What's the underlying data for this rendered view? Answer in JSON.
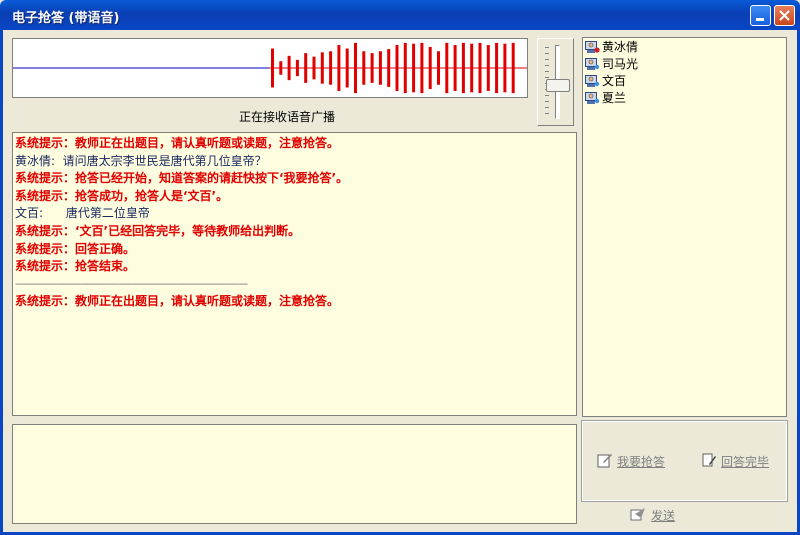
{
  "window": {
    "title": "电子抢答 (带语音)"
  },
  "audio": {
    "status": "正在接收语音广播",
    "bars": [
      0.72,
      0.25,
      0.45,
      0.3,
      0.55,
      0.42,
      0.58,
      0.62,
      0.85,
      0.72,
      0.93,
      0.62,
      0.55,
      0.62,
      0.7,
      0.85,
      0.93,
      0.9,
      0.93,
      0.78,
      0.62,
      0.93,
      0.85,
      0.93,
      0.9,
      0.93,
      0.85,
      0.93,
      0.9,
      0.93
    ]
  },
  "users": [
    {
      "name": "黄冰倩",
      "icon": "user-speaking-icon"
    },
    {
      "name": "司马光",
      "icon": "user-icon"
    },
    {
      "name": "文百",
      "icon": "user-icon"
    },
    {
      "name": "夏兰",
      "icon": "user-icon"
    }
  ],
  "messages": [
    {
      "type": "sys",
      "text": "系统提示：教师正在出题目，请认真听题或读题，注意抢答。"
    },
    {
      "type": "user",
      "text": "黄冰倩:  请问唐太宗李世民是唐代第几位皇帝？"
    },
    {
      "type": "sys",
      "text": "系统提示：抢答已经开始，知道答案的请赶快按下‘我要抢答’。"
    },
    {
      "type": "sys",
      "text": "系统提示：抢答成功，抢答人是‘文百’。"
    },
    {
      "type": "user",
      "text": "文百:      唐代第二位皇帝"
    },
    {
      "type": "sys",
      "text": "系统提示：‘文百’已经回答完毕，等待教师给出判断。"
    },
    {
      "type": "sys",
      "text": "系统提示：回答正确。"
    },
    {
      "type": "sys",
      "text": "系统提示：抢答结束。"
    },
    {
      "type": "sep",
      "text": "-----------------------------------------------------------------------------------------"
    },
    {
      "type": "sys",
      "text": "系统提示：教师正在出题目，请认真听题或读题，注意抢答。"
    }
  ],
  "actions": {
    "buzz": "我要抢答",
    "done": "回答完毕",
    "send": "发送"
  },
  "colors": {
    "system_text": "#e00000",
    "wave_bar": "#e00000",
    "wave_baseline": "#0000c0",
    "panel_bg": "#fffde0"
  }
}
